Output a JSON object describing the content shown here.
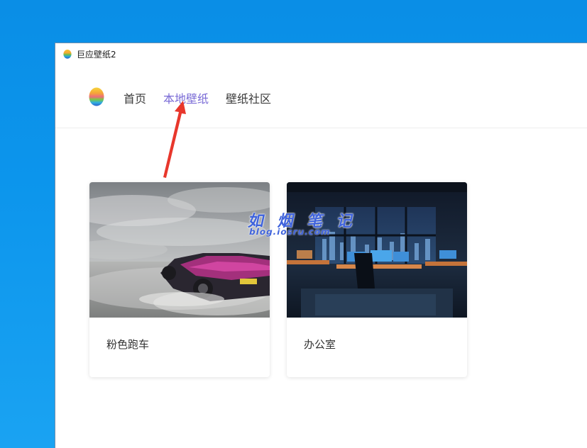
{
  "window": {
    "title": "巨应壁纸2",
    "app_icon": "colorful-egg-logo-icon"
  },
  "nav": {
    "logo": "colorful-egg-logo-icon",
    "items": [
      {
        "label": "首页",
        "active": false
      },
      {
        "label": "本地壁纸",
        "active": true
      },
      {
        "label": "壁纸社区",
        "active": false
      }
    ],
    "active_color": "#7a6bd6"
  },
  "wallpapers": [
    {
      "title": "粉色跑车",
      "thumb": "pink-sports-car-image"
    },
    {
      "title": "办公室",
      "thumb": "office-night-image"
    }
  ],
  "annotation": {
    "arrow_color": "#e8372c",
    "watermark_title": "如 烟 笔 记",
    "watermark_url": "blog.iosru.com"
  }
}
